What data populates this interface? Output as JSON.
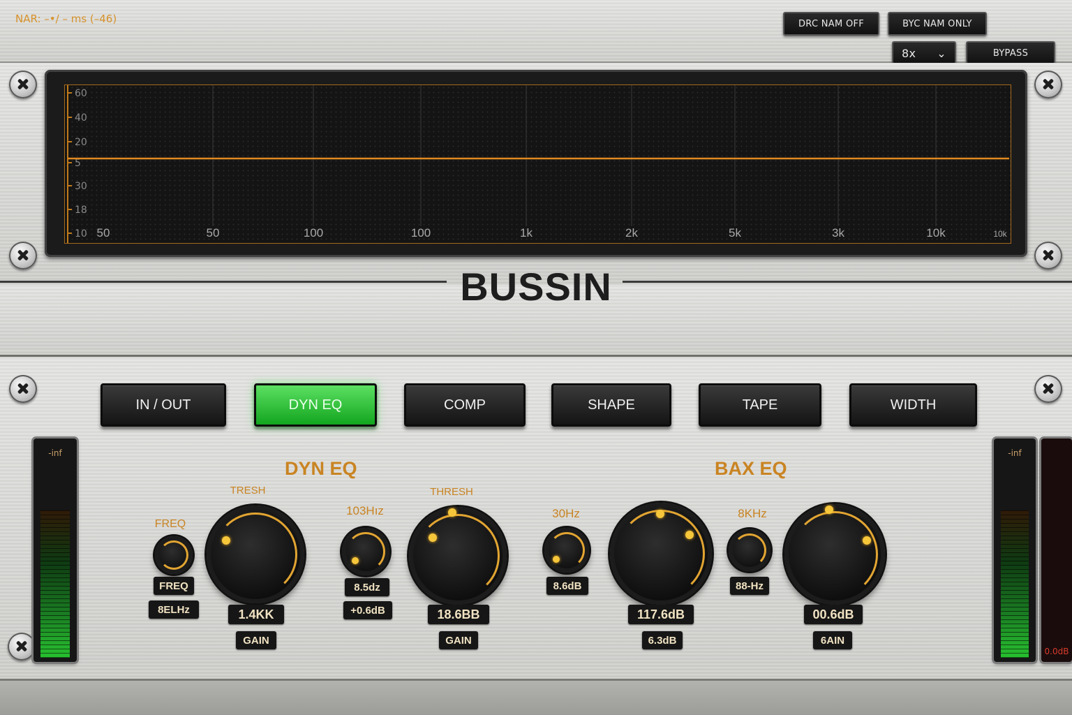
{
  "header": {
    "nar_text": "NAR: –•/ – ms (–46)",
    "drc_button": "DRC NAM OFF",
    "byc_button": "BYC NAM ONLY",
    "oversample_select": "8x",
    "bypass_button": "BYPASS"
  },
  "display": {
    "y_ticks": [
      "60",
      "40",
      "20",
      "5",
      "30",
      "18",
      "10"
    ],
    "x_ticks": [
      "50",
      "50",
      "100",
      "100",
      "1k",
      "2k",
      "5k",
      "3k",
      "10k",
      "10k"
    ],
    "curve_color": "#e08a1e"
  },
  "plugin_title": "BUSSIN",
  "modules": [
    {
      "label": "IN / OUT",
      "active": false
    },
    {
      "label": "DYN EQ",
      "active": true
    },
    {
      "label": "COMP",
      "active": false
    },
    {
      "label": "SHAPE",
      "active": false
    },
    {
      "label": "TAPE",
      "active": false
    },
    {
      "label": "WIDTH",
      "active": false
    }
  ],
  "dyn_eq": {
    "title": "DYN EQ",
    "freq_label_top": "FREQ",
    "freq_label": "FREQ",
    "freq_value": "8ELHz",
    "thresh1_label": "TRESH",
    "thresh1_value": "1.4KK",
    "gain1_label": "GAIN",
    "freq2_label": "103Hız",
    "freq2_value": "8.5dz",
    "gain2_value": "+0.6dB",
    "thresh2_label": "THRESH",
    "thresh2_value": "18.6BB",
    "gain3_label": "GAIN"
  },
  "bax_eq": {
    "title": "BAX EQ",
    "freq1_label": "30Hz",
    "freq1_value": "8.6dB",
    "knob1_value": "117.6dB",
    "knob1_sub": "6.3dB",
    "freq2_label": "8KHz",
    "freq2_value": "88-Hz",
    "knob2_value": "00.6dB",
    "knob2_label": "6AIN"
  },
  "meters": {
    "left_top": "-inf",
    "right_top": "-inf",
    "right_readout": "0.0dB",
    "left_level": 0.78,
    "right_level": 0.78
  },
  "colors": {
    "accent": "#c98422",
    "active_green": "#27c02f",
    "panel": "#d2d2cf"
  }
}
